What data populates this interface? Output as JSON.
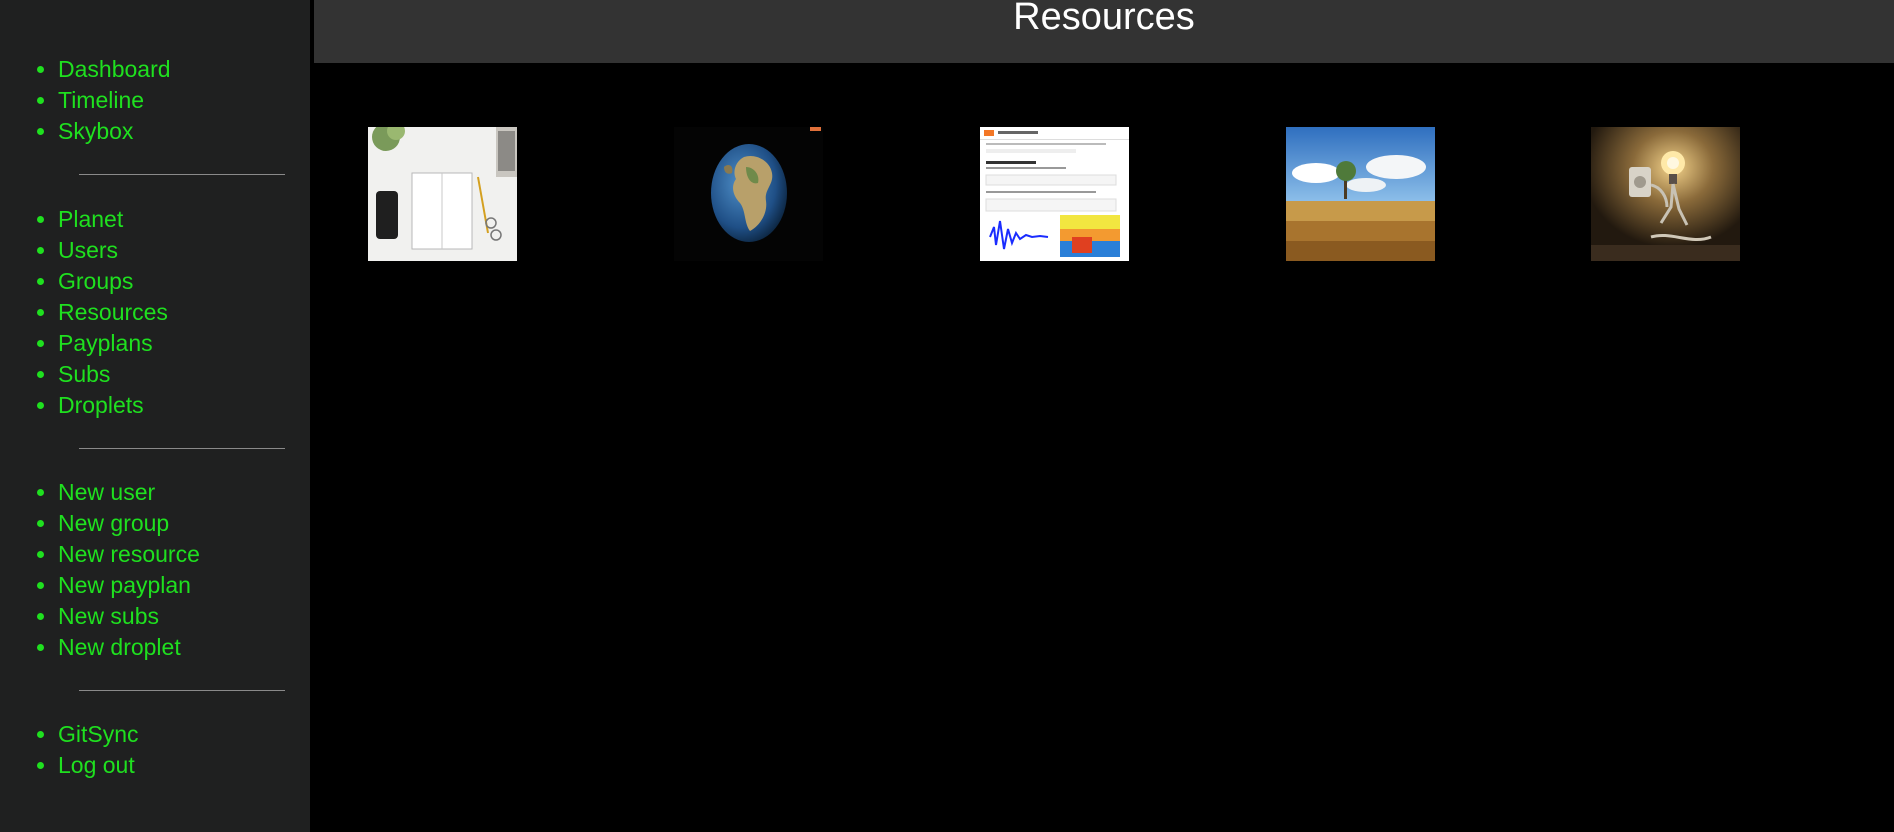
{
  "header": {
    "title": "Resources"
  },
  "sidebar": {
    "groups": [
      {
        "items": [
          {
            "label": "Dashboard"
          },
          {
            "label": "Timeline"
          },
          {
            "label": "Skybox"
          }
        ]
      },
      {
        "items": [
          {
            "label": "Planet"
          },
          {
            "label": "Users"
          },
          {
            "label": "Groups"
          },
          {
            "label": "Resources"
          },
          {
            "label": "Payplans"
          },
          {
            "label": "Subs"
          },
          {
            "label": "Droplets"
          }
        ]
      },
      {
        "items": [
          {
            "label": "New user"
          },
          {
            "label": "New group"
          },
          {
            "label": "New resource"
          },
          {
            "label": "New payplan"
          },
          {
            "label": "New subs"
          },
          {
            "label": "New droplet"
          }
        ]
      },
      {
        "items": [
          {
            "label": "GitSync"
          },
          {
            "label": "Log out"
          }
        ]
      }
    ]
  },
  "resources": [
    {
      "icon": "notebook-desk-image"
    },
    {
      "icon": "earth-image"
    },
    {
      "icon": "jupyter-notebook-screenshot"
    },
    {
      "icon": "wheat-field-sky-image"
    },
    {
      "icon": "lightbulb-outlet-image"
    }
  ],
  "colors": {
    "sidebar_bg": "#1f2020",
    "nav_link": "#1fe01f",
    "header_bg": "#333333",
    "page_bg": "#000000"
  }
}
